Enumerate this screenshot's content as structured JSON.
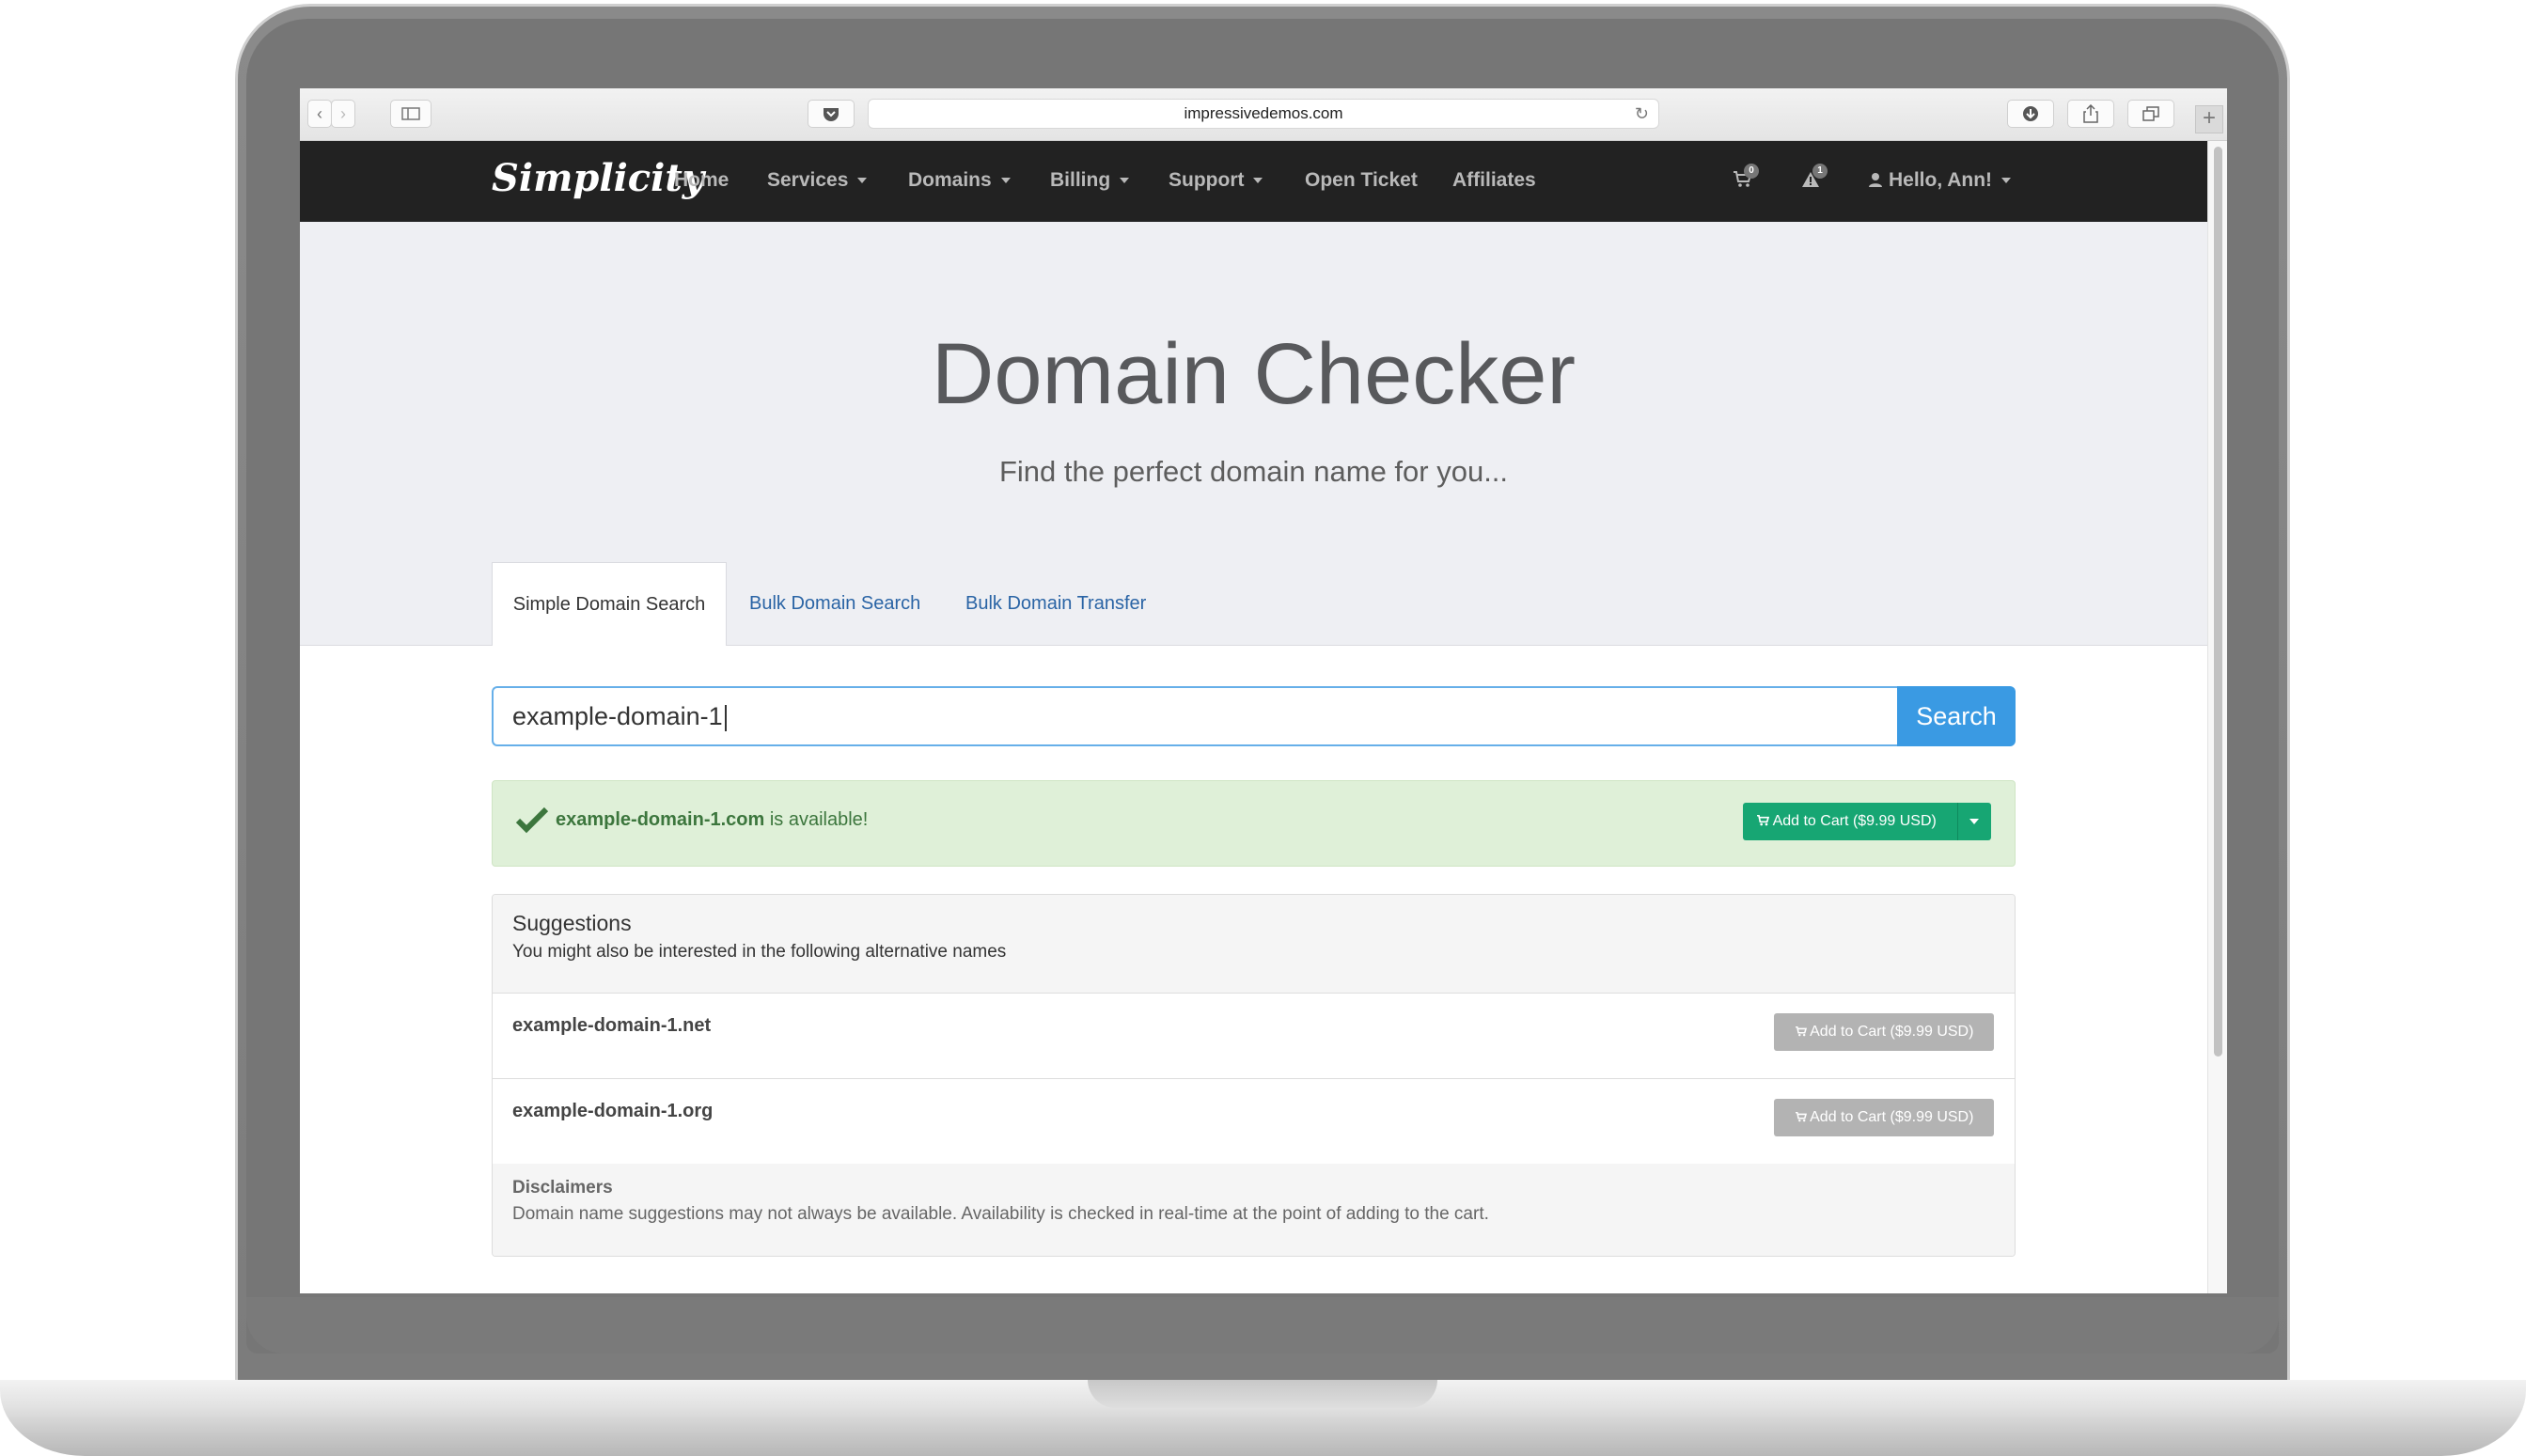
{
  "browser": {
    "url": "impressivedemos.com"
  },
  "nav": {
    "brand": "Simplicity",
    "items": [
      "Home",
      "Services",
      "Domains",
      "Billing",
      "Support",
      "Open Ticket",
      "Affiliates"
    ],
    "cart_count": "0",
    "alert_count": "1",
    "user_greeting": "Hello, Ann!"
  },
  "hero": {
    "title": "Domain Checker",
    "subtitle": "Find the perfect domain name for you..."
  },
  "tabs": [
    "Simple Domain Search",
    "Bulk Domain Search",
    "Bulk Domain Transfer"
  ],
  "search": {
    "value": "example-domain-1",
    "button": "Search"
  },
  "result": {
    "domain": "example-domain-1.com",
    "status_text": " is available!",
    "cart_label": "Add to Cart ($9.99 USD)"
  },
  "suggestions": {
    "title": "Suggestions",
    "subtitle": "You might also be interested in the following alternative names",
    "items": [
      {
        "domain": "example-domain-1.net",
        "cart_label": "Add to Cart ($9.99 USD)"
      },
      {
        "domain": "example-domain-1.org",
        "cart_label": "Add to Cart ($9.99 USD)"
      }
    ],
    "disclaimer_title": "Disclaimers",
    "disclaimer_text": "Domain name suggestions may not always be available. Availability is checked in real-time at the point of adding to the cart."
  },
  "colors": {
    "navbar": "#222222",
    "primary": "#3a9ae3",
    "success": "#17a673",
    "alert_bg": "#dff0d8",
    "link": "#2a64a5"
  }
}
